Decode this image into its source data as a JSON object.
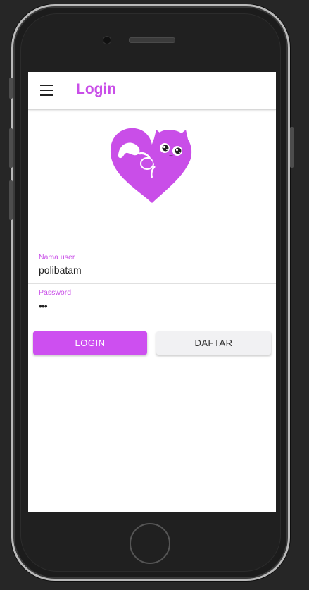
{
  "app": {
    "title": "Login"
  },
  "header": {
    "menu_icon": "hamburger-menu-icon"
  },
  "logo": {
    "icon": "heart-cat-logo",
    "color": "#c94ee8"
  },
  "form": {
    "username": {
      "label": "Nama user",
      "value": "polibatam"
    },
    "password": {
      "label": "Password",
      "value": "•••"
    }
  },
  "buttons": {
    "login_label": "LOGIN",
    "daftar_label": "DAFTAR"
  },
  "colors": {
    "accent": "#c94ee8",
    "focus_line": "#4ccb6f",
    "secondary_button": "#f1f1f3"
  }
}
